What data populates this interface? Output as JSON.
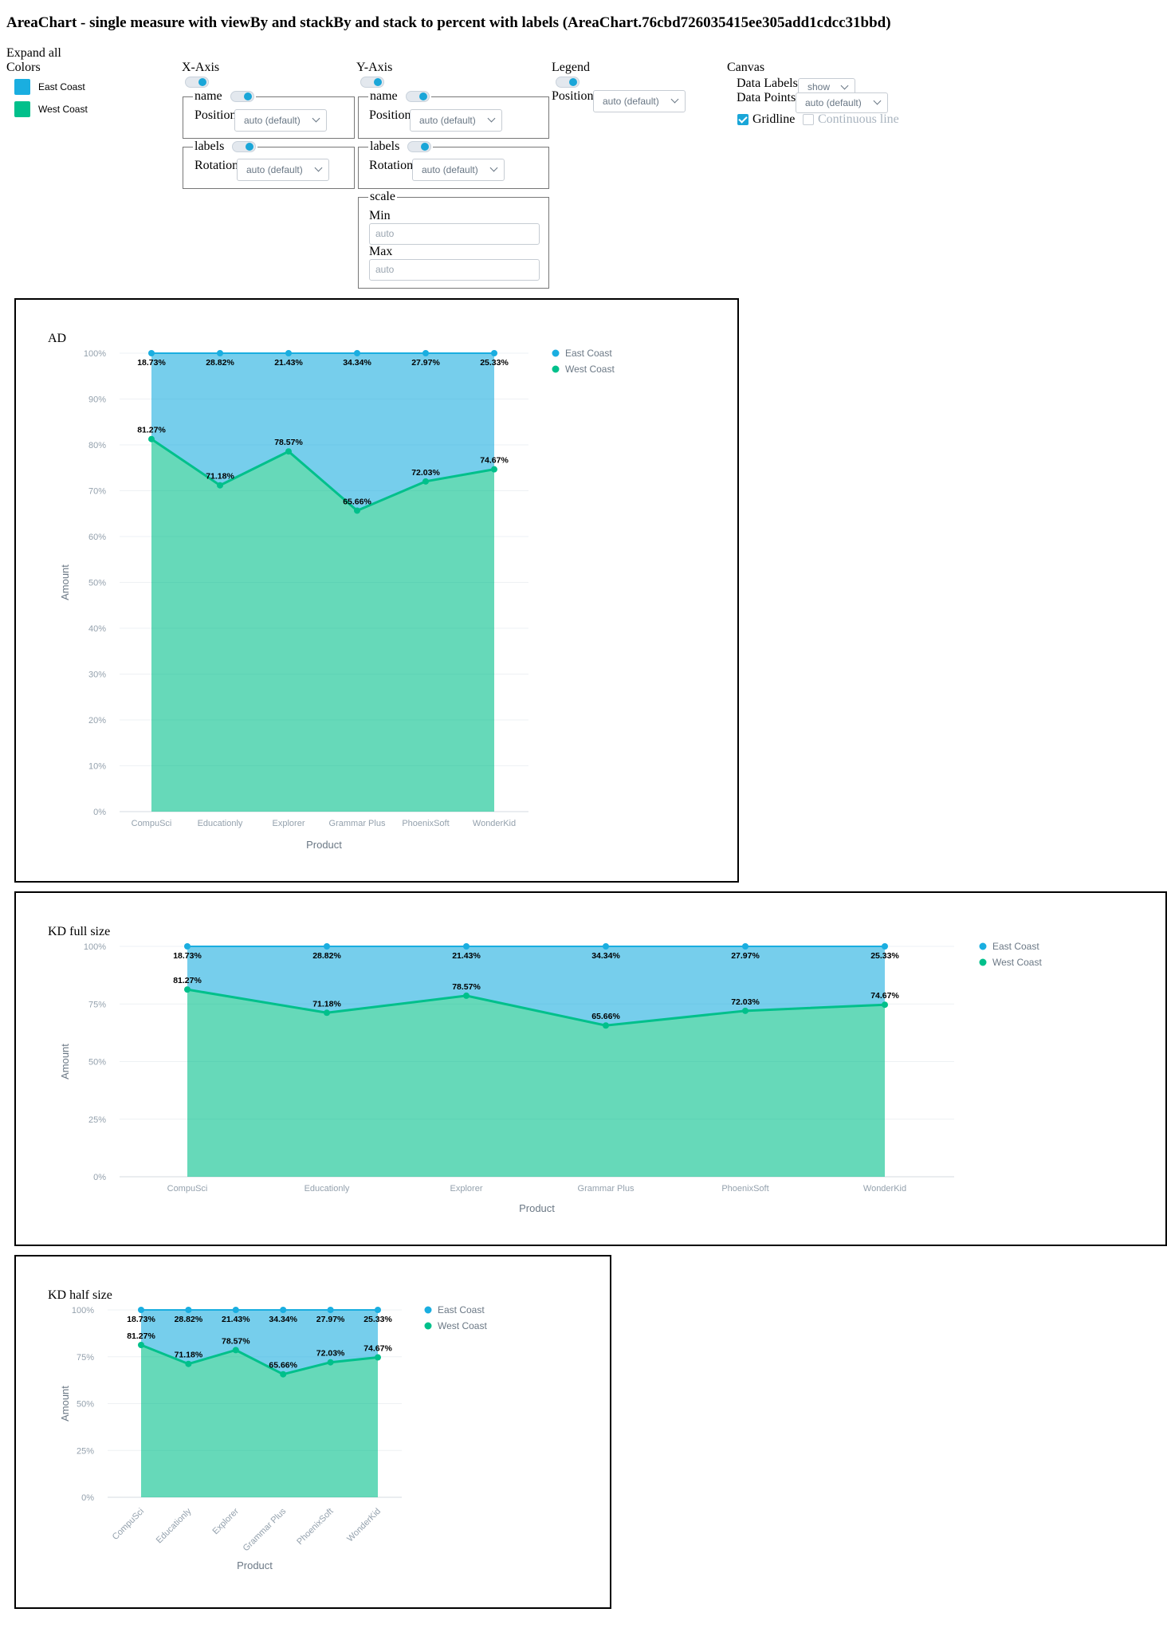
{
  "page": {
    "title": "AreaChart - single measure with viewBy and stackBy and stack to percent with labels (AreaChart.76cbd726035415ee305add1cdcc31bbd)"
  },
  "colors_panel": {
    "expand_all": "Expand all",
    "heading": "Colors",
    "items": [
      {
        "label": "East Coast",
        "color": "#1aaee0"
      },
      {
        "label": "West Coast",
        "color": "#00c08b"
      }
    ]
  },
  "x_axis": {
    "heading": "X-Axis",
    "name_legend": "name",
    "position_label": "Position",
    "position_value": "auto (default)",
    "labels_legend": "labels",
    "rotation_label": "Rotation",
    "rotation_value": "auto (default)"
  },
  "y_axis": {
    "heading": "Y-Axis",
    "name_legend": "name",
    "position_label": "Position",
    "position_value": "auto (default)",
    "labels_legend": "labels",
    "rotation_label": "Rotation",
    "rotation_value": "auto (default)",
    "scale_legend": "scale",
    "min_label": "Min",
    "min_placeholder": "auto",
    "max_label": "Max",
    "max_placeholder": "auto"
  },
  "legend_panel": {
    "heading": "Legend",
    "position_label": "Position",
    "position_value": "auto (default)"
  },
  "canvas_panel": {
    "heading": "Canvas",
    "data_labels_label": "Data Labels",
    "data_labels_value": "show",
    "data_points_label": "Data Points",
    "data_points_value": "auto (default)",
    "gridline_label": "Gridline",
    "gridline_checked": true,
    "continuous_label": "Continuous line",
    "continuous_checked": false
  },
  "chart_data": [
    {
      "type": "area",
      "title": "AD",
      "xlabel": "Product",
      "ylabel": "Amount",
      "categories": [
        "CompuSci",
        "Educationly",
        "Explorer",
        "Grammar Plus",
        "PhoenixSoft",
        "WonderKid"
      ],
      "stacked": "percent",
      "yticks": [
        "0%",
        "10%",
        "20%",
        "30%",
        "40%",
        "50%",
        "60%",
        "70%",
        "80%",
        "90%",
        "100%"
      ],
      "ylim": [
        0,
        100
      ],
      "grid": true,
      "legend": "right",
      "series": [
        {
          "name": "West Coast",
          "color": "#00c08b",
          "values": [
            81.27,
            71.18,
            78.57,
            65.66,
            72.03,
            74.67
          ],
          "labels": [
            "81.27%",
            "71.18%",
            "78.57%",
            "65.66%",
            "72.03%",
            "74.67%"
          ]
        },
        {
          "name": "East Coast",
          "color": "#1aaee0",
          "values": [
            18.73,
            28.82,
            21.43,
            34.34,
            27.97,
            25.33
          ],
          "labels": [
            "18.73%",
            "28.82%",
            "21.43%",
            "34.34%",
            "27.97%",
            "25.33%"
          ]
        }
      ]
    },
    {
      "type": "area",
      "title": "KD full size",
      "xlabel": "Product",
      "ylabel": "Amount",
      "categories": [
        "CompuSci",
        "Educationly",
        "Explorer",
        "Grammar Plus",
        "PhoenixSoft",
        "WonderKid"
      ],
      "stacked": "percent",
      "yticks": [
        "0%",
        "25%",
        "50%",
        "75%",
        "100%"
      ],
      "ylim": [
        0,
        100
      ],
      "grid": true,
      "legend": "right",
      "series": [
        {
          "name": "West Coast",
          "color": "#00c08b",
          "values": [
            81.27,
            71.18,
            78.57,
            65.66,
            72.03,
            74.67
          ],
          "labels": [
            "81.27%",
            "71.18%",
            "78.57%",
            "65.66%",
            "72.03%",
            "74.67%"
          ]
        },
        {
          "name": "East Coast",
          "color": "#1aaee0",
          "values": [
            18.73,
            28.82,
            21.43,
            34.34,
            27.97,
            25.33
          ],
          "labels": [
            "18.73%",
            "28.82%",
            "21.43%",
            "34.34%",
            "27.97%",
            "25.33%"
          ]
        }
      ]
    },
    {
      "type": "area",
      "title": "KD half size",
      "xlabel": "Product",
      "ylabel": "Amount",
      "categories": [
        "CompuSci",
        "Educationly",
        "Explorer",
        "Grammar Plus",
        "PhoenixSoft",
        "WonderKid"
      ],
      "stacked": "percent",
      "yticks": [
        "0%",
        "25%",
        "50%",
        "75%",
        "100%"
      ],
      "ylim": [
        0,
        100
      ],
      "grid": true,
      "legend": "right",
      "x_tick_rotation": "-45deg",
      "series": [
        {
          "name": "West Coast",
          "color": "#00c08b",
          "values": [
            81.27,
            71.18,
            78.57,
            65.66,
            72.03,
            74.67
          ],
          "labels": [
            "81.27%",
            "71.18%",
            "78.57%",
            "65.66%",
            "72.03%",
            "74.67%"
          ]
        },
        {
          "name": "East Coast",
          "color": "#1aaee0",
          "values": [
            18.73,
            28.82,
            21.43,
            34.34,
            27.97,
            25.33
          ],
          "labels": [
            "18.73%",
            "28.82%",
            "21.43%",
            "34.34%",
            "27.97%",
            "25.33%"
          ]
        }
      ]
    }
  ]
}
